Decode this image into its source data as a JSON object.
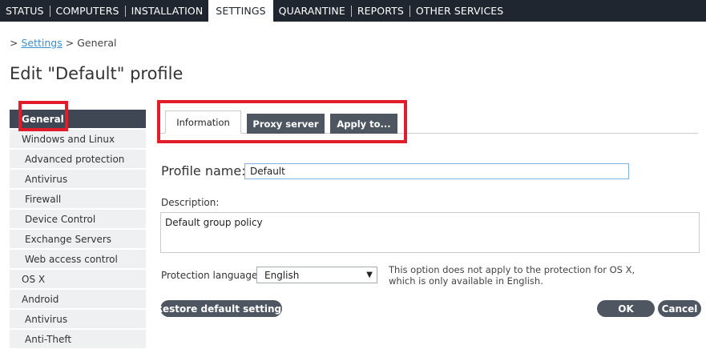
{
  "nav": {
    "items": [
      {
        "label": "STATUS"
      },
      {
        "label": "COMPUTERS"
      },
      {
        "label": "INSTALLATION"
      },
      {
        "label": "SETTINGS"
      },
      {
        "label": "QUARANTINE"
      },
      {
        "label": "REPORTS"
      },
      {
        "label": "OTHER SERVICES"
      }
    ]
  },
  "breadcrumb": {
    "prefix": ">",
    "link": "Settings",
    "separator": ">",
    "current": "General"
  },
  "page_title": "Edit \"Default\" profile",
  "sidebar": {
    "items": [
      {
        "label": "General"
      },
      {
        "label": "Windows and Linux"
      },
      {
        "label": "Advanced protection"
      },
      {
        "label": "Antivirus"
      },
      {
        "label": "Firewall"
      },
      {
        "label": "Device Control"
      },
      {
        "label": "Exchange Servers"
      },
      {
        "label": "Web access control"
      },
      {
        "label": "OS X"
      },
      {
        "label": "Android"
      },
      {
        "label": "Antivirus"
      },
      {
        "label": "Anti-Theft"
      }
    ]
  },
  "tabs": [
    {
      "label": "Information"
    },
    {
      "label": "Proxy server"
    },
    {
      "label": "Apply to..."
    }
  ],
  "form": {
    "profile_name_label": "Profile name:",
    "profile_name_value": "Default",
    "description_label": "Description:",
    "description_value": "Default group policy",
    "language_label": "Protection language:",
    "language_value": "English",
    "language_note": "This option does not apply to the protection for OS X, which is only available in English."
  },
  "buttons": {
    "restore": "Restore default settings",
    "ok": "OK",
    "cancel": "Cancel"
  },
  "colors": {
    "nav_bg": "#1f2630",
    "dark_button": "#4d5661",
    "highlight": "#e21c2a",
    "link": "#3a8fd1"
  }
}
